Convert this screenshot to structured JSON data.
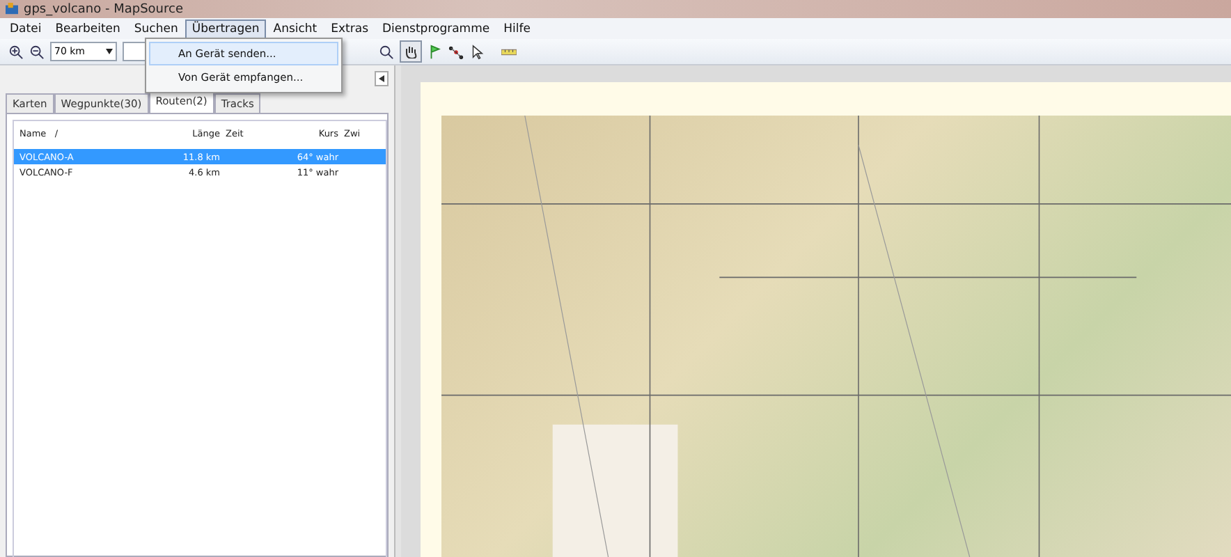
{
  "window": {
    "title": "gps_volcano - MapSource"
  },
  "menu": [
    {
      "label": "Datei",
      "selected": false
    },
    {
      "label": "Bearbeiten",
      "selected": false
    },
    {
      "label": "Suchen",
      "selected": false
    },
    {
      "label": "Übertragen",
      "selected": true
    },
    {
      "label": "Ansicht",
      "selected": false
    },
    {
      "label": "Extras",
      "selected": false
    },
    {
      "label": "Dienstprogramme",
      "selected": false
    },
    {
      "label": "Hilfe",
      "selected": false
    }
  ],
  "dropdown_menu": {
    "items": [
      {
        "label": "An Gerät senden...",
        "selected": true
      },
      {
        "label": "Von Gerät empfangen...",
        "selected": false
      }
    ]
  },
  "toolbar": {
    "zoom_select": {
      "value": "70 km"
    }
  },
  "tabs": [
    {
      "label": "Karten",
      "selected": false
    },
    {
      "label": "Wegpunkte(30)",
      "selected": false
    },
    {
      "label": "Routen(2)",
      "selected": true
    },
    {
      "label": "Tracks",
      "selected": false
    }
  ],
  "table": {
    "columns": [
      "Name   /",
      "Länge",
      "Zeit",
      "Kurs",
      "Zwi"
    ],
    "rows": [
      {
        "cells": [
          "VOLCANO-A",
          "11.8 km",
          "",
          "64° wahr"
        ],
        "selected": true
      },
      {
        "cells": [
          "VOLCANO-F",
          "4.6 km",
          "",
          "11° wahr"
        ],
        "selected": false
      }
    ]
  }
}
